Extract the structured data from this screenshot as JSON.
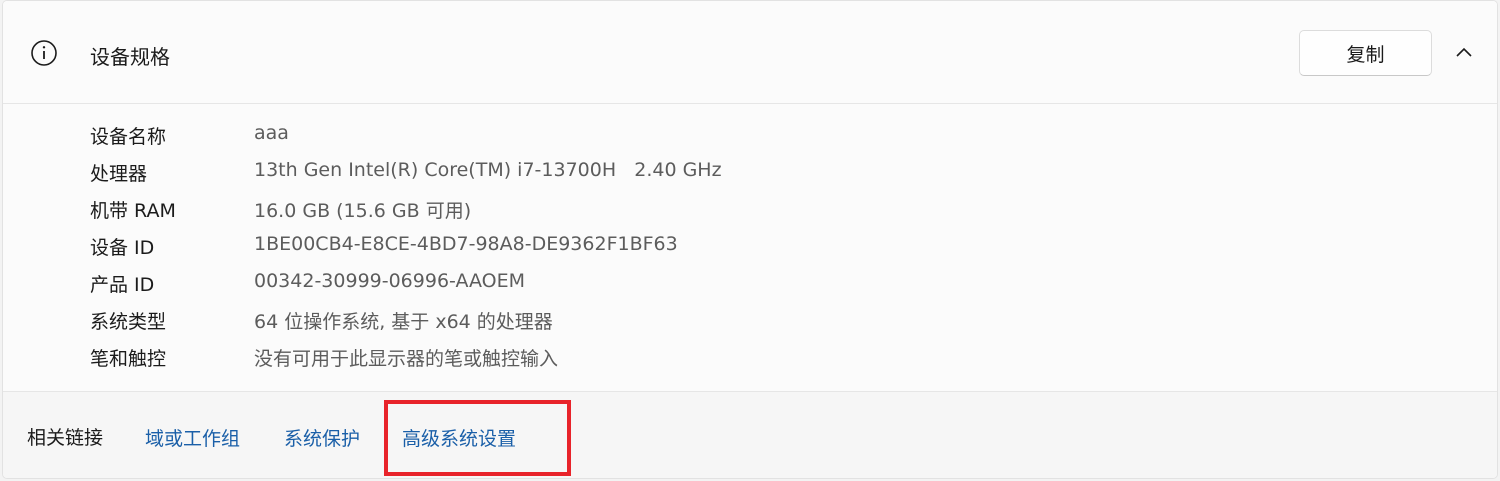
{
  "header": {
    "title": "设备规格",
    "copy_label": "复制",
    "icons": {
      "info": "info-icon",
      "collapse": "chevron-up-icon"
    }
  },
  "specs": [
    {
      "label": "设备名称",
      "value": "aaa"
    },
    {
      "label": "处理器",
      "value": "13th Gen Intel(R) Core(TM) i7-13700H   2.40 GHz"
    },
    {
      "label": "机带 RAM",
      "value": "16.0 GB (15.6 GB 可用)"
    },
    {
      "label": "设备 ID",
      "value": "1BE00CB4-E8CE-4BD7-98A8-DE9362F1BF63"
    },
    {
      "label": "产品 ID",
      "value": "00342-30999-06996-AAOEM"
    },
    {
      "label": "系统类型",
      "value": "64 位操作系统, 基于 x64 的处理器"
    },
    {
      "label": "笔和触控",
      "value": "没有可用于此显示器的笔或触控输入"
    }
  ],
  "footer": {
    "label": "相关链接",
    "links": [
      {
        "label": "域或工作组"
      },
      {
        "label": "系统保护"
      },
      {
        "label": "高级系统设置"
      }
    ]
  },
  "colors": {
    "link": "#1a5fa8",
    "highlight": "#e8232a"
  }
}
